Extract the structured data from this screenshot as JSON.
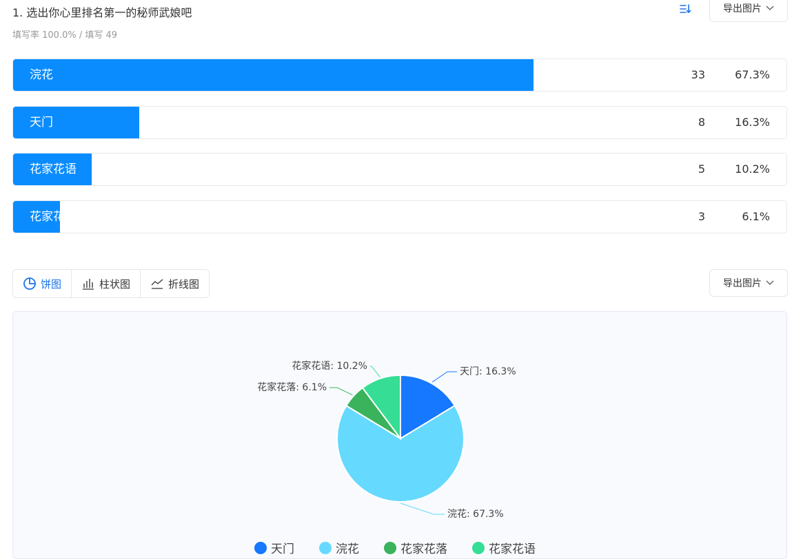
{
  "question": {
    "title": "1. 选出你心里排名第一的秘师武娘吧",
    "stats": "填写率 100.0% / 填写 49",
    "sort_icon": "sort-icon"
  },
  "export_label": "导出图片",
  "options": [
    {
      "label": "浣花",
      "count": "33",
      "percent": "67.3%",
      "fraction": 0.673
    },
    {
      "label": "天门",
      "count": "8",
      "percent": "16.3%",
      "fraction": 0.163
    },
    {
      "label": "花家花语",
      "count": "5",
      "percent": "10.2%",
      "fraction": 0.102
    },
    {
      "label": "花家花落",
      "count": "3",
      "percent": "6.1%",
      "fraction": 0.061
    }
  ],
  "chart_tabs": [
    {
      "label": "饼图",
      "icon": "pie-chart-icon",
      "active": true
    },
    {
      "label": "柱状图",
      "icon": "bar-chart-icon",
      "active": false
    },
    {
      "label": "折线图",
      "icon": "line-chart-icon",
      "active": false
    }
  ],
  "chart_data": {
    "type": "pie",
    "title": "",
    "legend_position": "bottom",
    "slices": [
      {
        "name": "天门",
        "value": 16.3,
        "label": "天门: 16.3%",
        "color": "#1677ff"
      },
      {
        "name": "浣花",
        "value": 67.3,
        "label": "浣花: 67.3%",
        "color": "#66d9ff"
      },
      {
        "name": "花家花落",
        "value": 6.1,
        "label": "花家花落: 6.1%",
        "color": "#3bb25c"
      },
      {
        "name": "花家花语",
        "value": 10.2,
        "label": "花家花语: 10.2%",
        "color": "#36de95"
      }
    ],
    "legend": [
      "天门",
      "浣花",
      "花家花落",
      "花家花语"
    ]
  },
  "colors": {
    "accent": "#0a8cff",
    "active_tab": "#1a73e8"
  }
}
